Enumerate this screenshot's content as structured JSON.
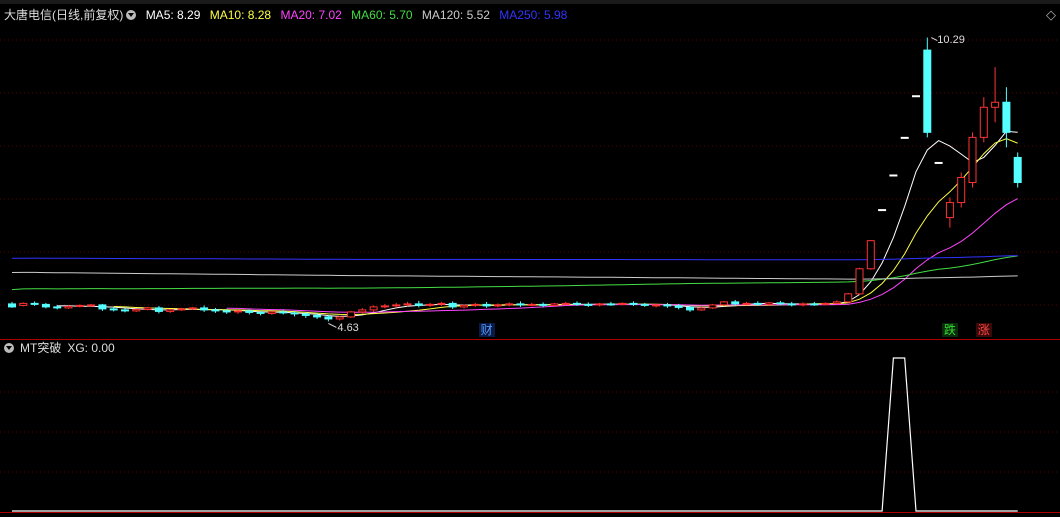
{
  "stock": {
    "name": "大唐电信",
    "period_label": "(日线,前复权)"
  },
  "main_header": {
    "ma": [
      {
        "label": "MA5: 8.29",
        "color": "#ffffff"
      },
      {
        "label": "MA10: 8.28",
        "color": "#ffff44"
      },
      {
        "label": "MA20: 7.02",
        "color": "#ff44ff"
      },
      {
        "label": "MA60: 5.70",
        "color": "#44dd44"
      },
      {
        "label": "MA120: 5.52",
        "color": "#cccccc"
      },
      {
        "label": "MA250: 5.98",
        "color": "#3333ff"
      }
    ]
  },
  "indicator": {
    "name": "MT突破",
    "value_label": "XG: 0.00"
  },
  "annotations": {
    "high_price": "10.29",
    "low_price": "4.63",
    "events": [
      {
        "label": "财",
        "color": "#5599ff",
        "bg": "#0a1a44"
      },
      {
        "label": "跌",
        "color": "#33dd33",
        "bg": "#0a2a0a"
      },
      {
        "label": "涨",
        "color": "#ff4444",
        "bg": "#3a0a0a"
      }
    ]
  },
  "chart_data": {
    "type": "candlestick",
    "candles": [
      [
        4.98,
        5.02,
        4.92,
        4.9
      ],
      [
        4.95,
        5.01,
        4.99,
        4.93
      ],
      [
        4.99,
        5.03,
        4.97,
        4.94
      ],
      [
        4.97,
        5.0,
        4.92,
        4.89
      ],
      [
        4.92,
        4.96,
        4.9,
        4.87
      ],
      [
        4.9,
        4.95,
        4.93,
        4.88
      ],
      [
        4.93,
        4.97,
        4.95,
        4.91
      ],
      [
        4.95,
        4.98,
        4.96,
        4.93
      ],
      [
        4.96,
        4.98,
        4.88,
        4.84
      ],
      [
        4.88,
        4.92,
        4.86,
        4.83
      ],
      [
        4.86,
        4.9,
        4.84,
        4.81
      ],
      [
        4.84,
        4.88,
        4.87,
        4.82
      ],
      [
        4.87,
        4.92,
        4.9,
        4.85
      ],
      [
        4.9,
        4.94,
        4.83,
        4.79
      ],
      [
        4.83,
        4.88,
        4.86,
        4.8
      ],
      [
        4.86,
        4.9,
        4.88,
        4.84
      ],
      [
        4.88,
        4.92,
        4.9,
        4.86
      ],
      [
        4.9,
        4.95,
        4.86,
        4.82
      ],
      [
        4.86,
        4.9,
        4.84,
        4.8
      ],
      [
        4.84,
        4.88,
        4.82,
        4.78
      ],
      [
        4.82,
        4.86,
        4.84,
        4.78
      ],
      [
        4.84,
        4.87,
        4.81,
        4.77
      ],
      [
        4.81,
        4.85,
        4.79,
        4.75
      ],
      [
        4.79,
        4.83,
        4.82,
        4.76
      ],
      [
        4.82,
        4.86,
        4.8,
        4.77
      ],
      [
        4.8,
        4.84,
        4.78,
        4.73
      ],
      [
        4.78,
        4.81,
        4.75,
        4.7
      ],
      [
        4.75,
        4.79,
        4.72,
        4.68
      ],
      [
        4.72,
        4.76,
        4.68,
        4.63
      ],
      [
        4.68,
        4.74,
        4.72,
        4.65
      ],
      [
        4.72,
        4.84,
        4.82,
        4.7
      ],
      [
        4.82,
        4.9,
        4.86,
        4.78
      ],
      [
        4.86,
        4.95,
        4.92,
        4.82
      ],
      [
        4.92,
        4.98,
        4.94,
        4.89
      ],
      [
        4.94,
        5.0,
        4.96,
        4.9
      ],
      [
        4.96,
        5.02,
        4.98,
        4.93
      ],
      [
        4.98,
        5.04,
        4.95,
        4.91
      ],
      [
        4.95,
        5.0,
        4.97,
        4.92
      ],
      [
        4.97,
        5.02,
        4.99,
        4.94
      ],
      [
        4.99,
        5.03,
        4.92,
        4.88
      ],
      [
        4.92,
        4.97,
        4.95,
        4.89
      ],
      [
        4.95,
        5.0,
        4.97,
        4.92
      ],
      [
        4.97,
        5.02,
        4.94,
        4.9
      ],
      [
        4.94,
        4.99,
        4.96,
        4.91
      ],
      [
        4.96,
        5.01,
        4.98,
        4.93
      ],
      [
        4.98,
        5.03,
        4.96,
        4.92
      ],
      [
        4.96,
        5.0,
        4.97,
        4.93
      ],
      [
        4.97,
        5.01,
        4.95,
        4.91
      ],
      [
        4.95,
        5.0,
        4.98,
        4.93
      ],
      [
        4.98,
        5.02,
        4.99,
        4.95
      ],
      [
        4.99,
        5.03,
        4.97,
        4.94
      ],
      [
        4.97,
        5.01,
        4.96,
        4.92
      ],
      [
        4.96,
        5.0,
        4.98,
        4.93
      ],
      [
        4.98,
        5.02,
        4.97,
        4.94
      ],
      [
        4.97,
        5.01,
        4.99,
        4.95
      ],
      [
        4.99,
        5.03,
        4.97,
        4.94
      ],
      [
        4.97,
        5.0,
        4.95,
        4.92
      ],
      [
        4.95,
        4.99,
        4.96,
        4.91
      ],
      [
        4.96,
        5.0,
        4.94,
        4.9
      ],
      [
        4.94,
        4.98,
        4.91,
        4.87
      ],
      [
        4.91,
        4.95,
        4.86,
        4.82
      ],
      [
        4.86,
        4.92,
        4.9,
        4.84
      ],
      [
        4.9,
        4.98,
        4.96,
        4.88
      ],
      [
        4.96,
        5.04,
        5.02,
        4.94
      ],
      [
        5.02,
        5.06,
        4.98,
        4.94
      ],
      [
        4.98,
        5.02,
        4.99,
        4.95
      ],
      [
        4.99,
        5.03,
        4.97,
        4.94
      ],
      [
        4.97,
        5.02,
        5.0,
        4.94
      ],
      [
        5.0,
        5.04,
        4.98,
        4.95
      ],
      [
        4.98,
        5.02,
        4.96,
        4.93
      ],
      [
        4.96,
        5.01,
        4.98,
        4.93
      ],
      [
        4.98,
        5.02,
        4.97,
        4.94
      ],
      [
        4.97,
        5.01,
        4.99,
        4.95
      ],
      [
        4.99,
        5.05,
        5.02,
        4.96
      ],
      [
        5.02,
        5.2,
        5.18,
        5.0
      ],
      [
        5.18,
        5.7,
        5.68,
        5.16
      ],
      [
        5.68,
        6.25,
        6.24,
        5.66
      ],
      [
        6.86,
        6.86,
        6.86,
        6.86
      ],
      [
        7.55,
        7.55,
        7.55,
        7.55
      ],
      [
        8.3,
        8.3,
        8.3,
        8.3
      ],
      [
        9.13,
        9.13,
        9.13,
        9.13
      ],
      [
        10.04,
        10.29,
        8.4,
        8.3
      ],
      [
        7.8,
        7.8,
        7.8,
        7.8
      ],
      [
        6.7,
        7.1,
        7.0,
        6.5
      ],
      [
        7.0,
        7.6,
        7.5,
        6.9
      ],
      [
        7.4,
        8.4,
        8.3,
        7.3
      ],
      [
        8.3,
        9.1,
        8.9,
        8.2
      ],
      [
        8.9,
        9.7,
        9.0,
        8.6
      ],
      [
        9.0,
        9.3,
        8.4,
        8.1
      ],
      [
        7.9,
        8.0,
        7.4,
        7.3
      ]
    ],
    "ma_series": [
      {
        "name": "MA5",
        "color": "#ffffff"
      },
      {
        "name": "MA10",
        "color": "#ffff44"
      },
      {
        "name": "MA20",
        "color": "#ff44ff"
      },
      {
        "name": "MA60",
        "color": "#44dd44"
      },
      {
        "name": "MA120",
        "color": "#cccccc"
      },
      {
        "name": "MA250",
        "color": "#3333ff"
      }
    ],
    "ma_known_last": {
      "MA60": 5.7,
      "MA120": 5.52,
      "MA250": 5.98
    },
    "ma_long_start": {
      "MA60": 5.45,
      "MA120": 5.7,
      "MA250": 6.02
    },
    "events_at_index": [
      42,
      83,
      86
    ],
    "high_index": 81,
    "low_index": 28,
    "indicator_signal": {
      "values": [
        0,
        0,
        0,
        0,
        0,
        0,
        0,
        0,
        0,
        0,
        0,
        0,
        0,
        0,
        0,
        0,
        0,
        0,
        0,
        0,
        0,
        0,
        0,
        0,
        0,
        0,
        0,
        0,
        0,
        0,
        0,
        0,
        0,
        0,
        0,
        0,
        0,
        0,
        0,
        0,
        0,
        0,
        0,
        0,
        0,
        0,
        0,
        0,
        0,
        0,
        0,
        0,
        0,
        0,
        0,
        0,
        0,
        0,
        0,
        0,
        0,
        0,
        0,
        0,
        0,
        0,
        0,
        0,
        0,
        0,
        0,
        0,
        0,
        0,
        0,
        0,
        0,
        0,
        1,
        1,
        0,
        0,
        0,
        0,
        0,
        0,
        0,
        0,
        0,
        0
      ],
      "ylim": [
        0,
        1
      ]
    },
    "ylim": [
      4.3,
      10.6
    ]
  }
}
